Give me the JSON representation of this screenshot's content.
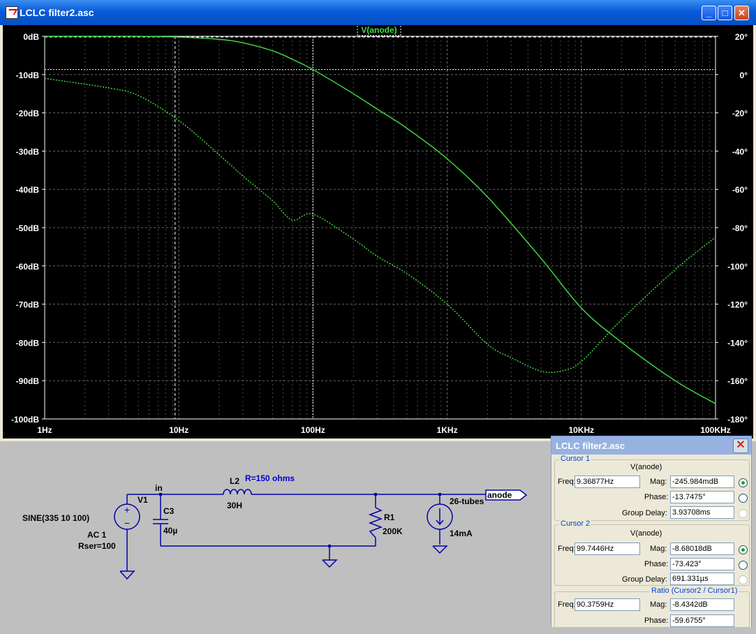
{
  "window": {
    "title": "LCLC filter2.asc",
    "buttons": {
      "minimize": "_",
      "maximize": "□",
      "close": "✕"
    }
  },
  "plot": {
    "trace_label": "V(anode)",
    "left_ticks": [
      "0dB",
      "-10dB",
      "-20dB",
      "-30dB",
      "-40dB",
      "-50dB",
      "-60dB",
      "-70dB",
      "-80dB",
      "-90dB",
      "-100dB"
    ],
    "right_ticks": [
      "20°",
      "0°",
      "-20°",
      "-40°",
      "-60°",
      "-80°",
      "-100°",
      "-120°",
      "-140°",
      "-160°",
      "-180°"
    ],
    "x_ticks": [
      "1Hz",
      "10Hz",
      "100Hz",
      "1KHz",
      "10KHz",
      "100KHz"
    ],
    "colors": {
      "background": "#000000",
      "trace": "#44dd44",
      "grid": "#808080",
      "axis_text": "#ffffff"
    }
  },
  "chart_data": {
    "type": "line",
    "xscale": "log",
    "xlim": [
      1,
      100000
    ],
    "ylim": [
      -100,
      0
    ],
    "ylim_right": [
      -180,
      20
    ],
    "grid": true,
    "series": [
      {
        "name": "",
        "role": "magnitude",
        "axis": "left",
        "x": [
          1,
          3,
          5,
          10,
          20,
          30,
          50,
          70,
          100,
          200,
          300,
          500,
          1000,
          2000,
          5000,
          10000,
          20000,
          50000,
          100000
        ],
        "y": [
          0,
          0,
          0,
          -0.2,
          -0.8,
          -1.7,
          -3.8,
          -6,
          -8.7,
          -15,
          -19,
          -24,
          -32,
          -42,
          -58,
          -71,
          -80,
          -90,
          -96
        ]
      },
      {
        "name": "",
        "role": "phase",
        "axis": "right",
        "x": [
          1,
          3,
          5,
          10,
          20,
          30,
          50,
          70,
          100,
          200,
          300,
          500,
          1000,
          2000,
          3000,
          5000,
          7000,
          10000,
          20000,
          50000,
          100000
        ],
        "y": [
          -2,
          -7,
          -11,
          -24,
          -42,
          -53,
          -66,
          -76,
          -73,
          -86,
          -95,
          -104,
          -120,
          -141,
          -148,
          -155,
          -155,
          -150,
          -128,
          -102,
          -85
        ]
      }
    ],
    "cursors": [
      {
        "name": "Cursor 1",
        "freq": "9.36877Hz"
      },
      {
        "name": "Cursor 2",
        "freq": "99.7446Hz"
      }
    ]
  },
  "schematic": {
    "source_name": "V1",
    "source_spec": "SINE(335 10 100)",
    "source_ac": "AC 1",
    "source_rser": "Rser=100",
    "node_in": "in",
    "c3_name": "C3",
    "c3_value": "40µ",
    "l2_name": "L2",
    "l2_value": "30H",
    "l2_rser": "R=150 ohms",
    "r1_name": "R1",
    "r1_value": "200K",
    "i_name": "26-tubes",
    "i_value": "14mA",
    "port_label": "anode",
    "colors": {
      "wire": "#0000aa",
      "label": "#000000",
      "param": "#0000cc"
    }
  },
  "cursor_panel": {
    "title": "LCLC filter2.asc",
    "close": "✕",
    "cursor1": {
      "group": "Cursor 1",
      "trace": "V(anode)",
      "freq_label": "Freq:",
      "freq": "9.36877Hz",
      "mag_label": "Mag:",
      "mag": "-245.984mdB",
      "phase_label": "Phase:",
      "phase": "-13.7475°",
      "gd_label": "Group Delay:",
      "gd": "3.93708ms"
    },
    "cursor2": {
      "group": "Cursor 2",
      "trace": "V(anode)",
      "freq_label": "Freq:",
      "freq": "99.7446Hz",
      "mag_label": "Mag:",
      "mag": "-8.68018dB",
      "phase_label": "Phase:",
      "phase": "-73.423°",
      "gd_label": "Group Delay:",
      "gd": "691.331µs"
    },
    "ratio": {
      "group": "Ratio (Cursor2 / Cursor1)",
      "freq_label": "Freq:",
      "freq": "90.3759Hz",
      "mag_label": "Mag:",
      "mag": "-8.4342dB",
      "phase_label": "Phase:",
      "phase": "-59.6755°"
    }
  }
}
